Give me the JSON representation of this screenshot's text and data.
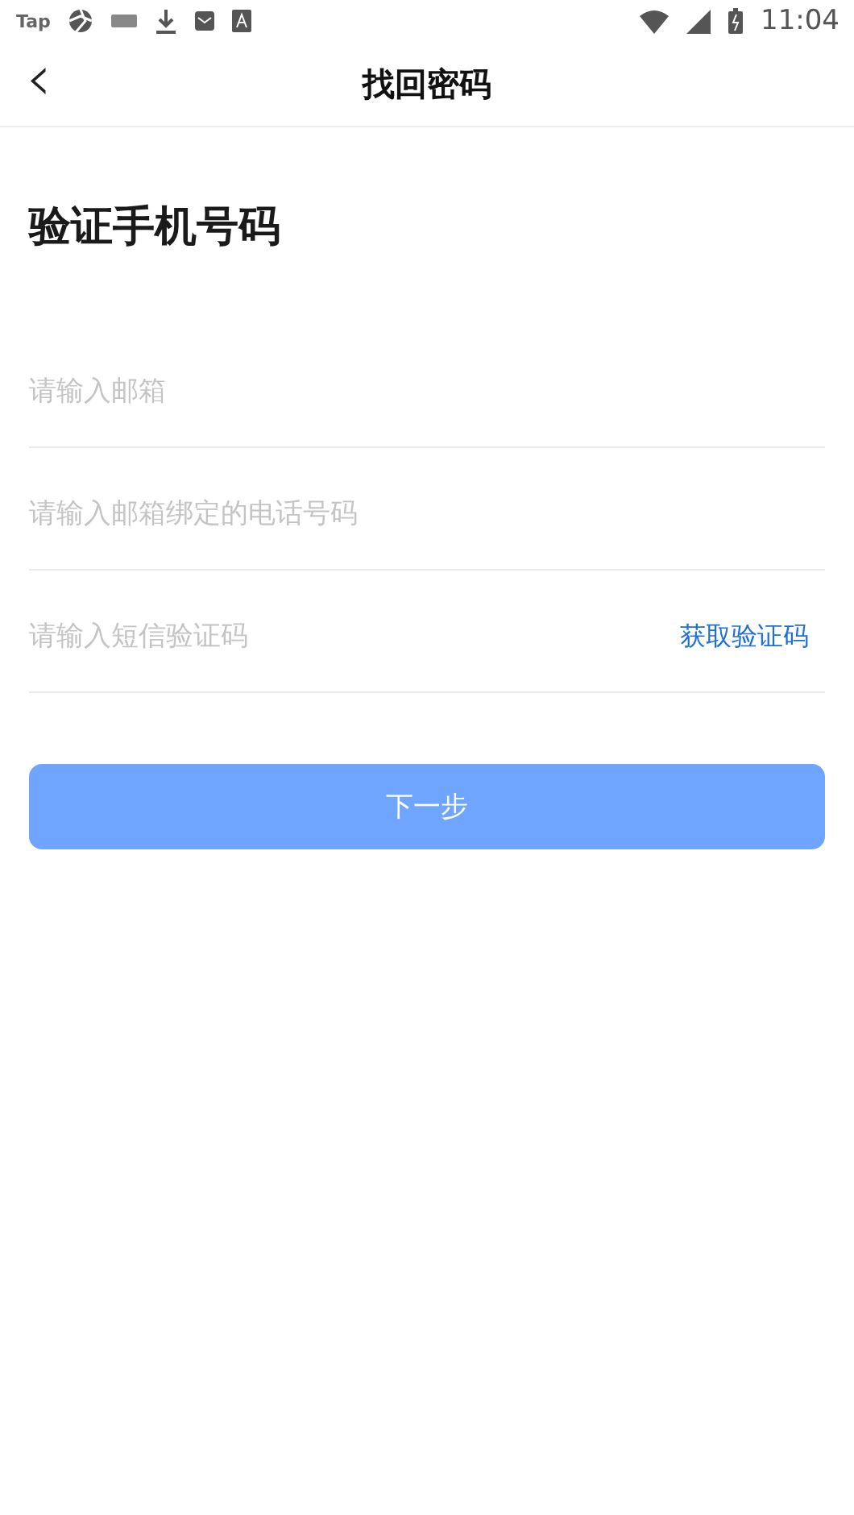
{
  "status_bar": {
    "app_label": "Tap",
    "time": "11:04"
  },
  "nav": {
    "back": "‹",
    "title": "找回密码"
  },
  "heading": "验证手机号码",
  "fields": [
    {
      "placeholder": "请输入邮箱"
    },
    {
      "placeholder": "请输入邮箱绑定的电话号码"
    },
    {
      "placeholder": "请输入短信验证码",
      "action": "获取验证码"
    }
  ],
  "submit": {
    "label": "下一步",
    "disabled": true
  }
}
